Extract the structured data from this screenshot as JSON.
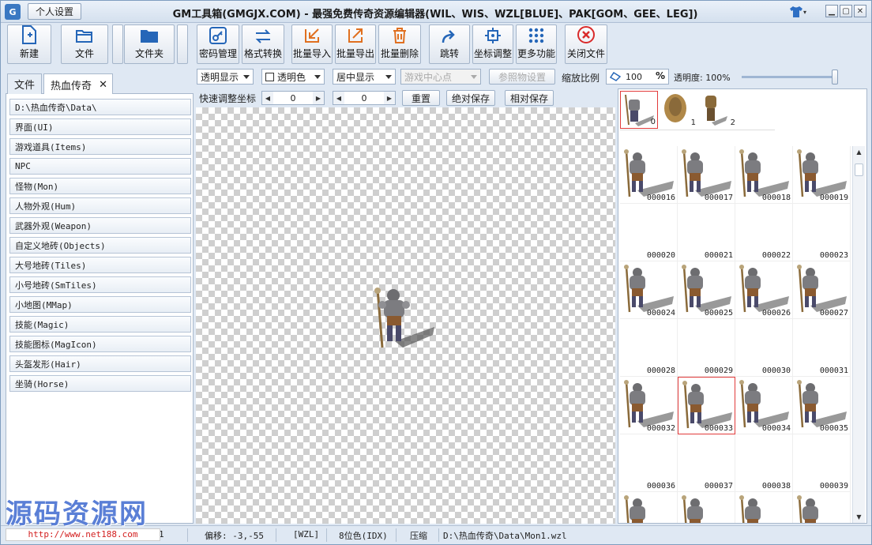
{
  "window": {
    "title": "GM工具箱(GMGJX.COM) - 最强免费传奇资源编辑器(WIL、WIS、WZL[BLUE]、PAK[GOM、GEE、LEG])",
    "personal_settings": "个人设置"
  },
  "toolbar": {
    "new": "新建",
    "file": "文件",
    "folder": "文件夹",
    "password": "密码管理",
    "format": "格式转换",
    "batch_import": "批量导入",
    "batch_export": "批量导出",
    "batch_delete": "批量删除",
    "jump": "跳转",
    "coord": "坐标调整",
    "more": "更多功能",
    "close_file": "关闭文件"
  },
  "options": {
    "display": "透明显示",
    "transparent_color": "透明色",
    "center": "居中显示",
    "game_center": "游戏中心点",
    "ref_setting": "参照物设置",
    "zoom_label": "缩放比例",
    "zoom_value": "100",
    "percent": "%",
    "opacity": "透明度: 100%",
    "opacity_level": 1.0
  },
  "coord_bar": {
    "label": "快速调整坐标",
    "x": "0",
    "y": "0",
    "reset": "重置",
    "abs_save": "绝对保存",
    "rel_save": "相对保存"
  },
  "left": {
    "tabs": [
      "文件",
      "热血传奇"
    ],
    "items": [
      "D:\\热血传奇\\Data\\",
      "界面(UI)",
      "游戏道具(Items)",
      "NPC",
      "怪物(Mon)",
      "人物外观(Hum)",
      "武器外观(Weapon)",
      "自定义地砖(Objects)",
      "大号地砖(Tiles)",
      "小号地砖(SmTiles)",
      "小地图(MMap)",
      "技能(Magic)",
      "技能图标(MagIcon)",
      "头盔发形(Hair)",
      "坐骑(Horse)"
    ]
  },
  "files": [
    "0",
    "1",
    "2"
  ],
  "frames": [
    {
      "n": "000016",
      "img": true
    },
    {
      "n": "000017",
      "img": true
    },
    {
      "n": "000018",
      "img": true
    },
    {
      "n": "000019",
      "img": true
    },
    {
      "n": "000020",
      "img": false
    },
    {
      "n": "000021",
      "img": false
    },
    {
      "n": "000022",
      "img": false
    },
    {
      "n": "000023",
      "img": false
    },
    {
      "n": "000024",
      "img": true
    },
    {
      "n": "000025",
      "img": true
    },
    {
      "n": "000026",
      "img": true
    },
    {
      "n": "000027",
      "img": true
    },
    {
      "n": "000028",
      "img": false
    },
    {
      "n": "000029",
      "img": false
    },
    {
      "n": "000030",
      "img": false
    },
    {
      "n": "000031",
      "img": false
    },
    {
      "n": "000032",
      "img": true
    },
    {
      "n": "000033",
      "img": true,
      "sel": true
    },
    {
      "n": "000034",
      "img": true
    },
    {
      "n": "000035",
      "img": true
    },
    {
      "n": "000036",
      "img": false
    },
    {
      "n": "000037",
      "img": false
    },
    {
      "n": "000038",
      "img": false
    },
    {
      "n": "000039",
      "img": false
    },
    {
      "n": "",
      "img": true
    },
    {
      "n": "",
      "img": true
    },
    {
      "n": "",
      "img": true
    },
    {
      "n": "",
      "img": true
    }
  ],
  "status": {
    "partial": "1",
    "offset": "偏移: -3,-55",
    "format": "[WZL]",
    "color": "8位色(IDX)",
    "compress": "压缩",
    "path": "D:\\热血传奇\\Data\\Mon1.wzl"
  },
  "watermark": {
    "title": "源码资源网",
    "url": "http://www.net188.com"
  }
}
